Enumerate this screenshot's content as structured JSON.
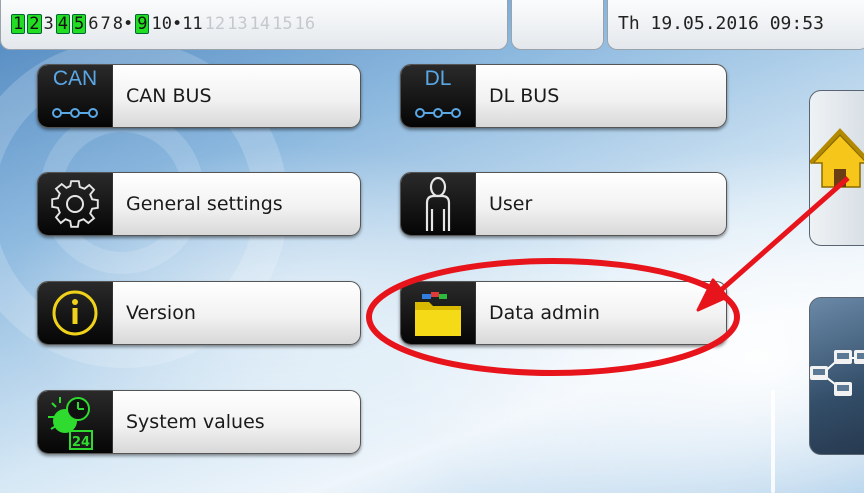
{
  "status_bar": {
    "nodes": [
      {
        "label": "1",
        "state": "active"
      },
      {
        "label": "2",
        "state": "active"
      },
      {
        "label": "3",
        "state": "normal"
      },
      {
        "label": "4",
        "state": "active"
      },
      {
        "label": "5",
        "state": "active"
      },
      {
        "label": "6",
        "state": "normal"
      },
      {
        "label": "7",
        "state": "normal"
      },
      {
        "label": "8•",
        "state": "normal"
      },
      {
        "label": "9",
        "state": "active"
      },
      {
        "label": "10•11",
        "state": "normal"
      },
      {
        "label": "12",
        "state": "faded"
      },
      {
        "label": "13",
        "state": "faded"
      },
      {
        "label": "14",
        "state": "faded"
      },
      {
        "label": "15",
        "state": "faded"
      },
      {
        "label": "16",
        "state": "faded"
      }
    ],
    "datetime": "Th 19.05.2016 09:53"
  },
  "menu": {
    "can_bus": {
      "label": "CAN BUS",
      "icon": "can-bus-icon",
      "icon_text": "CAN"
    },
    "dl_bus": {
      "label": "DL BUS",
      "icon": "dl-bus-icon",
      "icon_text": "DL"
    },
    "general_settings": {
      "label": "General settings",
      "icon": "gear-icon"
    },
    "user": {
      "label": "User",
      "icon": "user-icon"
    },
    "version": {
      "label": "Version",
      "icon": "info-icon"
    },
    "data_admin": {
      "label": "Data admin",
      "icon": "folder-icon"
    },
    "system_values": {
      "label": "System values",
      "icon": "system-values-icon",
      "icon_text": "24"
    }
  },
  "side": {
    "home": {
      "icon": "home-icon"
    },
    "network": {
      "icon": "network-icon"
    }
  },
  "annotation": {
    "color": "#e8141b"
  },
  "colors": {
    "active_node": "#22dd22",
    "button_icon_bg": "#0a0a0a"
  }
}
